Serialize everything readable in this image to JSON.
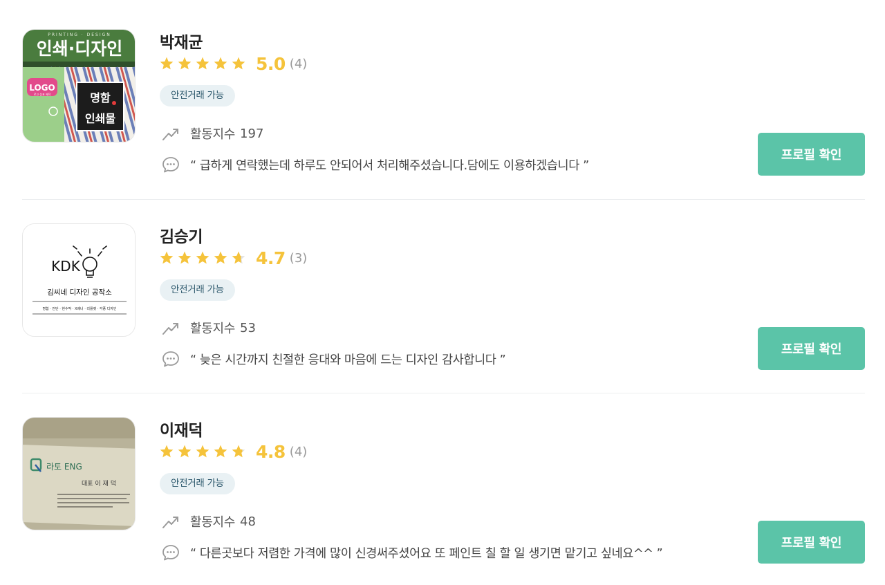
{
  "icons": {
    "star": "star-icon",
    "activity": "trending-up-icon",
    "review": "speech-bubble-icon"
  },
  "colors": {
    "star_filled": "#f5c33b",
    "star_empty": "#e1e1e1",
    "accent_button": "#5bc4a8",
    "badge_bg": "#e9f1f4",
    "badge_text": "#2f5a6e"
  },
  "sellers": [
    {
      "name": "박재균",
      "rating": 5.0,
      "rating_text": "5.0",
      "review_count": "(4)",
      "badge": "안전거래 가능",
      "activity_label": "활동지수",
      "activity_value": "197",
      "review": "“ 급하게 연락했는데 하루도 안되어서 처리해주셨습니다.담에도 이용하겠습니다 ”",
      "button_label": "프로필 확인",
      "image": {
        "sign_top": "인쇄·디자인",
        "sign_band": "PRINTING · DESIGN",
        "logo": "LOGO",
        "logo_sub": "로고 상표 제작",
        "panel_line1": "명함",
        "panel_line2": "인쇄물"
      }
    },
    {
      "name": "김승기",
      "rating": 4.7,
      "rating_text": "4.7",
      "review_count": "(3)",
      "badge": "안전거래 가능",
      "activity_label": "활동지수",
      "activity_value": "53",
      "review": "“ 늦은 시간까지 친절한 응대와 마음에 드는 디자인 감사합니다 ”",
      "button_label": "프로필 확인",
      "image": {
        "logo": "KDK",
        "tagline": "김씨네 디자인 공작소",
        "services": "명함 · 전단 · 현수막 · X배너 · 리플렛 · 각종 디자인"
      }
    },
    {
      "name": "이재덕",
      "rating": 4.8,
      "rating_text": "4.8",
      "review_count": "(4)",
      "badge": "안전거래 가능",
      "activity_label": "활동지수",
      "activity_value": "48",
      "review": "“ 다른곳보다 저렴한 가격에 많이 신경써주셨어요 또 페인트 칠 할 일 생기면 맡기고 싶네요^^ ”",
      "button_label": "프로필 확인",
      "image": {
        "company": "라토 ENG",
        "person": "대표 이 재 덕"
      }
    }
  ]
}
